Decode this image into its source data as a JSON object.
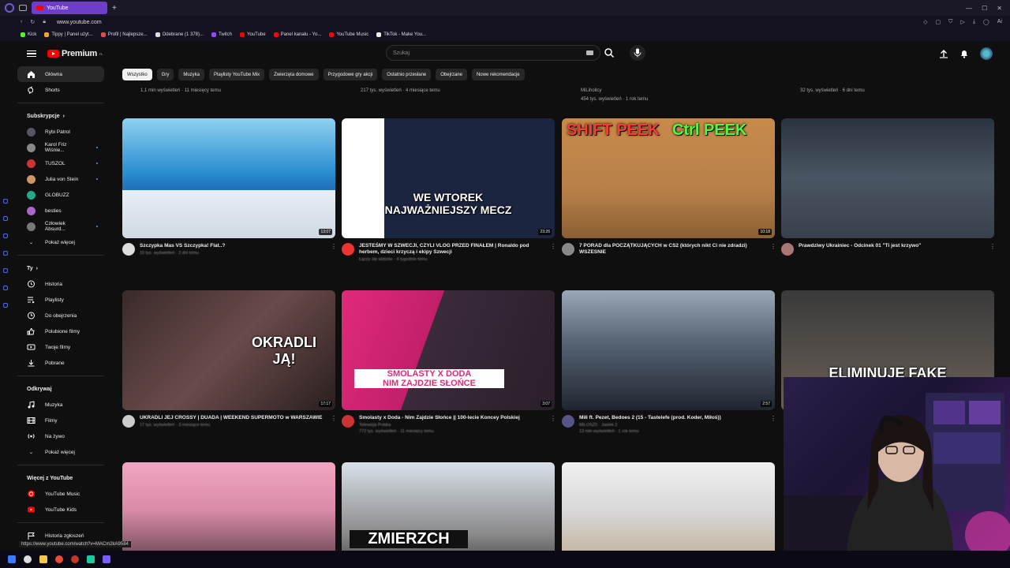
{
  "browser": {
    "tab_title": "YouTube",
    "url": "www.youtube.com",
    "bookmarks": [
      {
        "label": "Kick",
        "color": "#53fc18"
      },
      {
        "label": "Tippy | Panel użyt...",
        "color": "#f5a623"
      },
      {
        "label": "Profil | Najlepsze...",
        "color": "#e04a4a"
      },
      {
        "label": "Odebrane (1 378)...",
        "color": "#dddddd"
      },
      {
        "label": "Twitch",
        "color": "#9146ff"
      },
      {
        "label": "YouTube",
        "color": "#ff0000"
      },
      {
        "label": "Panel kanału - Yo...",
        "color": "#ff0000"
      },
      {
        "label": "YouTube Music",
        "color": "#ff0000"
      },
      {
        "label": "TikTok - Make You...",
        "color": "#eeeeee"
      }
    ],
    "status_url": "https://www.youtube.com/watch?v=MACm2kA9584"
  },
  "header": {
    "logo": "Premium",
    "logo_sup": "PL",
    "search_placeholder": "Szukaj"
  },
  "sidebar": {
    "main": [
      {
        "label": "Główna",
        "icon": "home-icon",
        "active": true
      },
      {
        "label": "Shorts",
        "icon": "shorts-icon"
      }
    ],
    "subs_heading": "Subskrypcje",
    "subs": [
      {
        "label": "Rybi Patrol",
        "color": "#556"
      },
      {
        "label": "Karol Friz Wiśnie...",
        "color": "#888",
        "live": true
      },
      {
        "label": "TUSZOL",
        "color": "#c33",
        "live": true
      },
      {
        "label": "Julia von Stein",
        "color": "#c96",
        "live": true
      },
      {
        "label": "GLOBUZZ",
        "color": "#2a8"
      },
      {
        "label": "besties",
        "color": "#a6c"
      },
      {
        "label": "Człowiek Absurd...",
        "color": "#777",
        "live": true
      }
    ],
    "subs_more": "Pokaż więcej",
    "you_heading": "Ty",
    "you": [
      {
        "label": "Historia",
        "icon": "history-icon"
      },
      {
        "label": "Playlisty",
        "icon": "playlist-icon"
      },
      {
        "label": "Do obejrzenia",
        "icon": "clock-icon"
      },
      {
        "label": "Polubione filmy",
        "icon": "like-icon"
      },
      {
        "label": "Twoje filmy",
        "icon": "video-icon"
      },
      {
        "label": "Pobrane",
        "icon": "download-icon"
      }
    ],
    "explore_heading": "Odkrywaj",
    "explore": [
      {
        "label": "Muzyka",
        "icon": "music-icon"
      },
      {
        "label": "Filmy",
        "icon": "film-icon"
      },
      {
        "label": "Na żywo",
        "icon": "live-icon"
      }
    ],
    "explore_more": "Pokaż więcej",
    "more_heading": "Więcej z YouTube",
    "more": [
      {
        "label": "YouTube Music",
        "icon": "yt-music-icon"
      },
      {
        "label": "YouTube Kids",
        "icon": "yt-kids-icon"
      }
    ],
    "report": "Historia zgłoszeń"
  },
  "chips": [
    "Wszystko",
    "Gry",
    "Muzyka",
    "Playlisty YouTube Mix",
    "Zwierzęta domowe",
    "Przygodowe gry akcji",
    "Ostatnio przesłane",
    "Obejrzane",
    "Nowe rekomendacje"
  ],
  "prev_row": [
    {
      "meta": "1,1 mln wyświetleń · 11 miesięcy temu"
    },
    {
      "meta": "217 tys. wyświetleń · 4 miesiące temu"
    },
    {
      "channel": "MiLihollcy",
      "meta": "454 tys. wyświetleń · 1 rok temu"
    },
    {
      "meta": "32 tys. wyświetleń · 6 dni temu"
    }
  ],
  "videos": [
    {
      "title": "Szczypka Mas VS Szczypka! Flat..?",
      "channel": "",
      "meta": "10 tys. wyświetleń · 2 dni temu",
      "duration": "13:07",
      "overlay": ""
    },
    {
      "title": "JESTEŚMY W SZWECJI, CZYLI VLOG PRZED FINAŁEM | Ronaldo pod herbem, dzieci krzyczą i ekipy Szwecji",
      "channel": "",
      "meta": "Łączy się widzów · 4 tygodnie temu",
      "duration": "23:26",
      "overlay": "WE WTOREK\nNAJWAŻNIEJSZY MECZ"
    },
    {
      "title": "7 PORAD dla POCZĄTKUJĄCYCH w CS2 (których nikt Ci nie zdradzi) WSZESNIE",
      "channel": "",
      "meta": "",
      "duration": "10:18",
      "overlay": "SHIFT PEEK|Ctrl PEEK"
    },
    {
      "title": "Prawdziwy Ukrainiec - Odcinek 01 \"Ti jest krzywo\"",
      "channel": "",
      "meta": "",
      "duration": "",
      "overlay": ""
    },
    {
      "title": "UKRADLI JEJ CROSSY | DUADA | WEEKEND SUPERMOTO w WARSZAWIE",
      "channel": "",
      "meta": "17 tys. wyświetleń · 3 miesiące temu",
      "duration": "17:17",
      "overlay": "OKRADLI\nJĄ!"
    },
    {
      "title": "Smolasty x Doda - Nim Zajdzie Słońce || 100-lecie Koncey Polskiej",
      "channel": "Telewizja Polska",
      "meta": "772 tys. wyświetleń · 11 miesięcy temu",
      "duration": "3:07",
      "overlay": "SMOLASTY X DODA\nNIM ZAJDZIE SŁOŃCE"
    },
    {
      "title": "Miłi ft. Pezet, Bedoes 2 (15 - Tastelefe (prod. Koder, Miłoś))",
      "channel": "MiLOSZ0 · Jasiek 2",
      "meta": "13 mln wyświetleń · 1 rok temu",
      "duration": "2:57",
      "overlay": ""
    },
    {
      "title": "",
      "channel": "",
      "meta": "",
      "duration": "",
      "overlay": "ELIMINUJE FAKE"
    },
    {
      "title": "",
      "channel": "",
      "meta": "",
      "duration": "",
      "overlay": ""
    },
    {
      "title": "",
      "channel": "",
      "meta": "",
      "duration": "",
      "overlay": "ZMIERZCH"
    },
    {
      "title": "",
      "channel": "",
      "meta": "",
      "duration": "",
      "overlay": ""
    }
  ]
}
